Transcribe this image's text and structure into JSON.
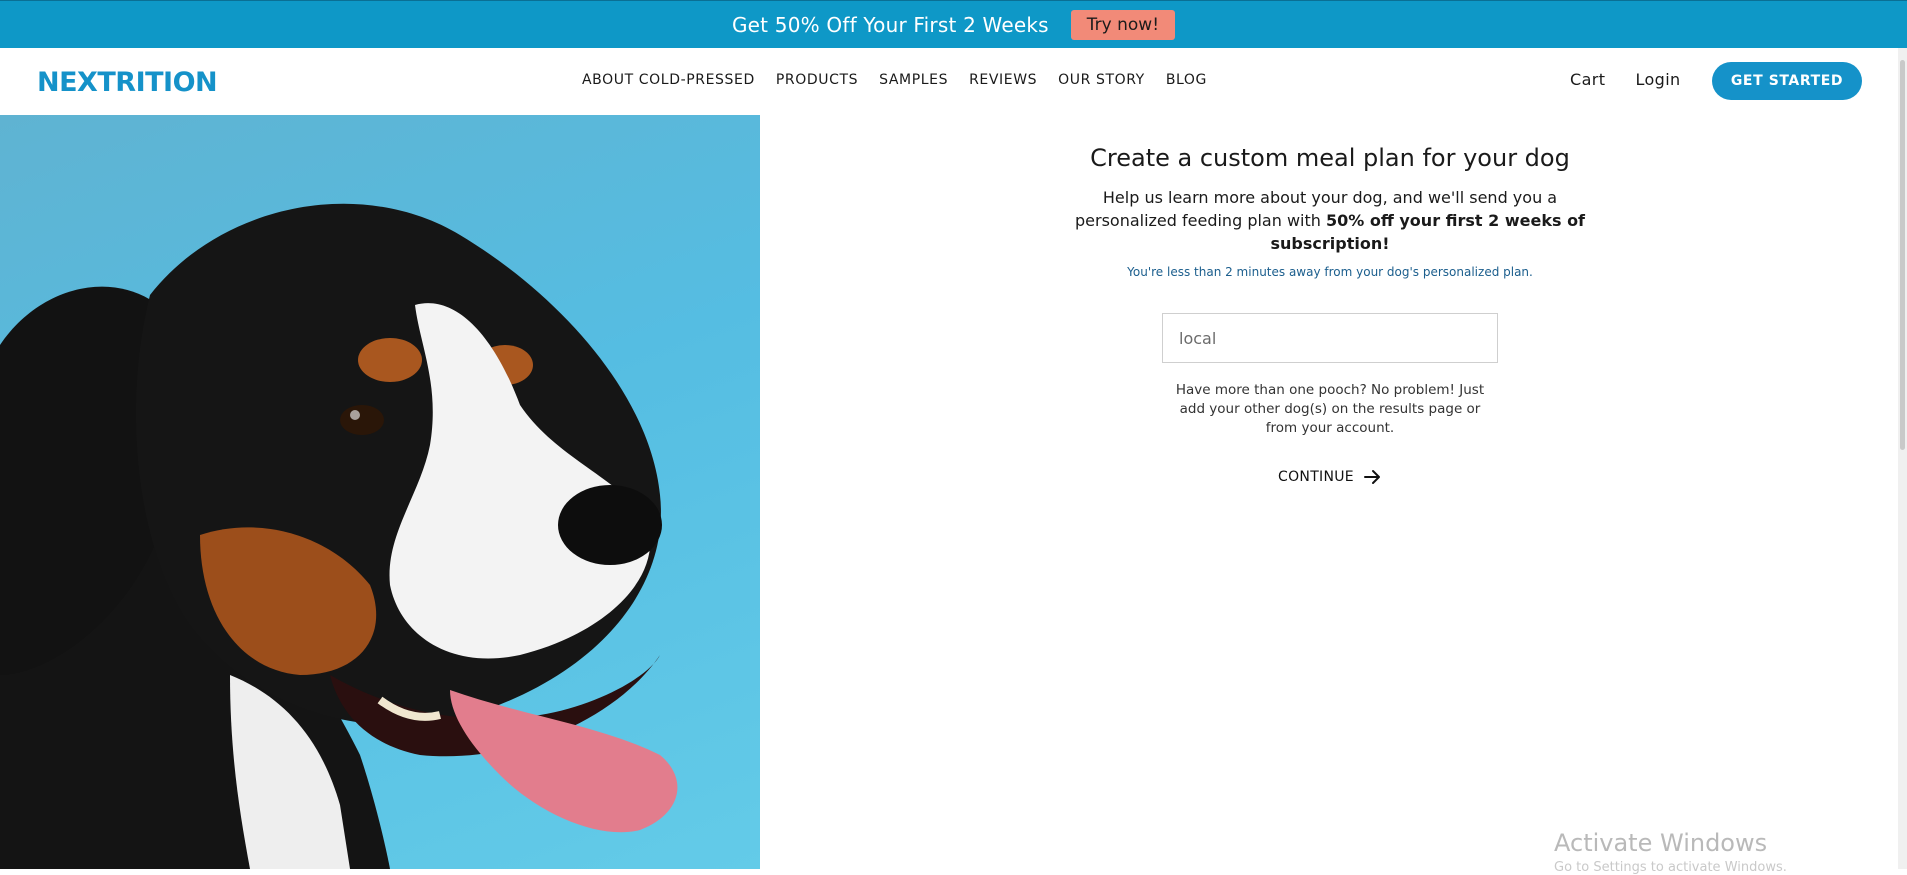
{
  "promo": {
    "text": "Get 50% Off Your First 2 Weeks",
    "button": "Try now!"
  },
  "header": {
    "logo": "NEXTRITION",
    "nav": [
      "ABOUT COLD-PRESSED",
      "PRODUCTS",
      "SAMPLES",
      "REVIEWS",
      "OUR STORY",
      "BLOG"
    ],
    "cart": "Cart",
    "login": "Login",
    "cta": "GET STARTED"
  },
  "form": {
    "title": "Create a custom meal plan for your dog",
    "intro_part1": "Help us learn more about your dog, and we'll send you a personalized feeding plan with ",
    "intro_bold": "50% off your first 2 weeks of subscription!",
    "note": "You're less than 2 minutes away from your dog's personalized plan.",
    "dog_name_value": "local",
    "multi_dog_text": "Have more than one pooch? No problem! Just add your other dog(s) on the results page or from your account.",
    "continue": "CONTINUE"
  },
  "colors": {
    "brand": "#1592c9",
    "promo_bg": "#0e98c7",
    "promo_button": "#f28a78"
  },
  "watermark": {
    "title": "Activate Windows",
    "subtitle": "Go to Settings to activate Windows."
  }
}
